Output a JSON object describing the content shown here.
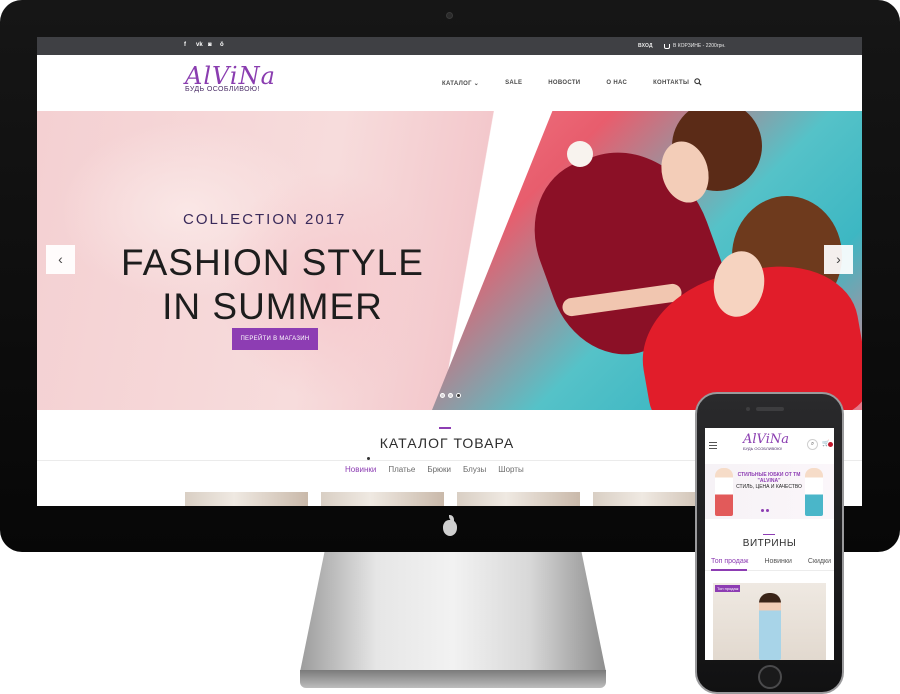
{
  "desktop": {
    "topbar": {
      "social_icons": [
        "facebook-icon",
        "vk-icon",
        "instagram-icon",
        "odnoklassniki-icon"
      ],
      "social_glyphs": [
        "f",
        "vk",
        "◙",
        "ǒ"
      ],
      "login": "ВХОД",
      "cart": "В КОРЗИНЕ - 2200грн."
    },
    "logo": {
      "brand": "AlViNa",
      "tagline": "БУДЬ ОСОБЛИВОЮ!"
    },
    "nav": [
      "КАТАЛОГ",
      "SALE",
      "НОВОСТИ",
      "О НАС",
      "КОНТАКТЫ"
    ],
    "hero": {
      "subtitle": "COLLECTION 2017",
      "title_line1": "FASHION STYLE",
      "title_line2": "IN SUMMER",
      "button": "ПЕРЕЙТИ В МАГАЗИН",
      "prev": "‹",
      "next": "›",
      "slides": 3,
      "active_slide": 1
    },
    "catalog": {
      "title": "КАТАЛОГ ТОВАРА",
      "tabs": [
        "Новинки",
        "Платье",
        "Брюки",
        "Блузы",
        "Шорты"
      ],
      "active_tab": "Новинки"
    }
  },
  "mobile": {
    "logo": {
      "brand": "AlViNa",
      "tagline": "БУДЬ ОСОБЛИВОЮ!"
    },
    "banner": {
      "line1": "СТИЛЬНЫЕ ЮБКИ ОТ ТМ \"ALVINA\"",
      "line2": "СТИЛЬ, ЦЕНА И КАЧЕСТВО"
    },
    "section_title": "ВИТРИНЫ",
    "tabs": [
      "Топ продаж",
      "Новинки",
      "Скидки"
    ],
    "active_tab": "Топ продаж",
    "product_badge": "Топ продаж"
  },
  "colors": {
    "accent": "#8d3db3",
    "topbar": "#3f4044",
    "brand": "#8a3db0"
  }
}
